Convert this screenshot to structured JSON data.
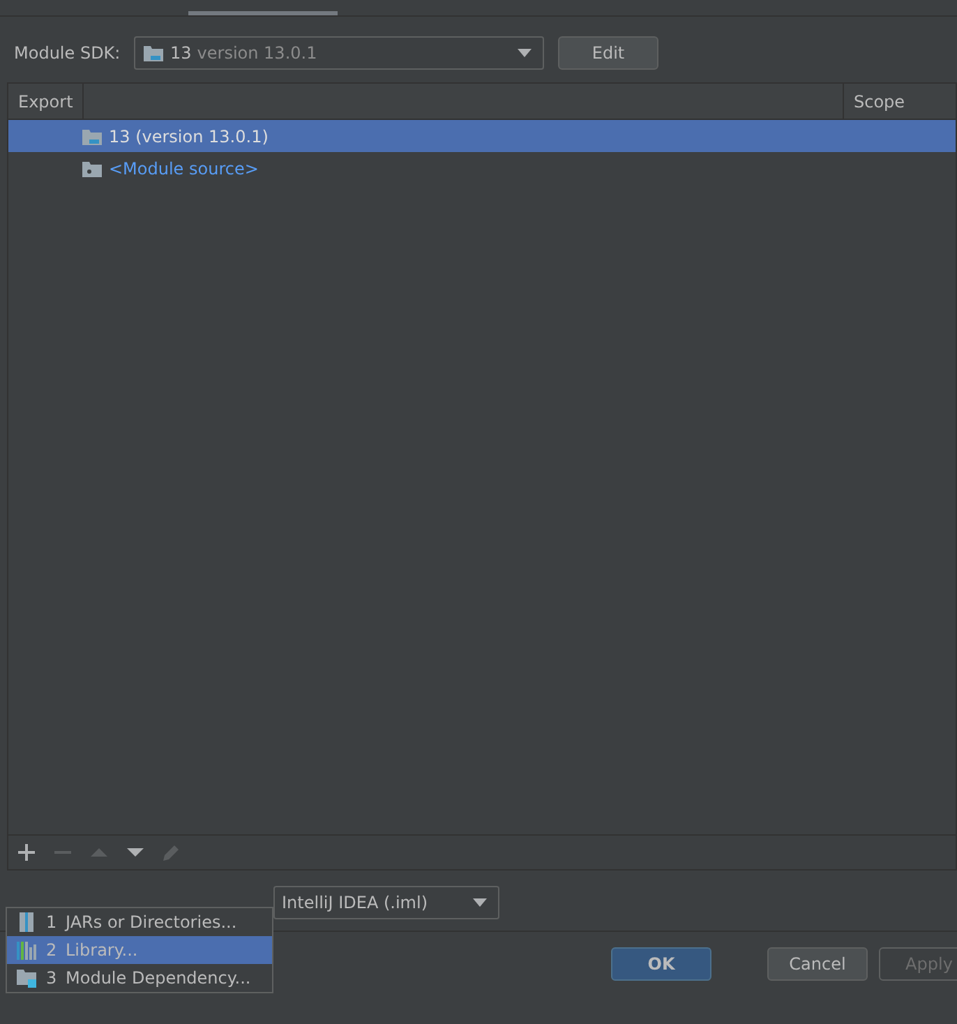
{
  "sdk": {
    "label": "Module SDK:",
    "value_name": "13",
    "value_version": "version 13.0.1",
    "edit_button": "Edit"
  },
  "table": {
    "columns": [
      "Export",
      "Scope"
    ],
    "rows": [
      {
        "kind": "sdk",
        "text": "13 (version 13.0.1)",
        "selected": true
      },
      {
        "kind": "source",
        "text": "<Module source>",
        "selected": false
      }
    ]
  },
  "toolbar": [
    {
      "kind": "add",
      "disabled": false
    },
    {
      "kind": "remove",
      "disabled": true
    },
    {
      "kind": "up",
      "disabled": true
    },
    {
      "kind": "down",
      "disabled": false
    },
    {
      "kind": "edit",
      "disabled": true
    }
  ],
  "format_combo": {
    "value": "IntelliJ IDEA (.iml)"
  },
  "popup_menu": [
    {
      "kind": "jars",
      "number": "1",
      "label": "JARs or Directories...",
      "selected": false
    },
    {
      "kind": "library",
      "number": "2",
      "label": "Library...",
      "selected": true
    },
    {
      "kind": "module",
      "number": "3",
      "label": "Module Dependency...",
      "selected": false
    }
  ],
  "buttons": [
    {
      "label": "OK",
      "kind": "default",
      "disabled": false
    },
    {
      "label": "Cancel",
      "kind": "normal",
      "disabled": false
    },
    {
      "label": "Apply",
      "kind": "normal",
      "disabled": true
    }
  ]
}
